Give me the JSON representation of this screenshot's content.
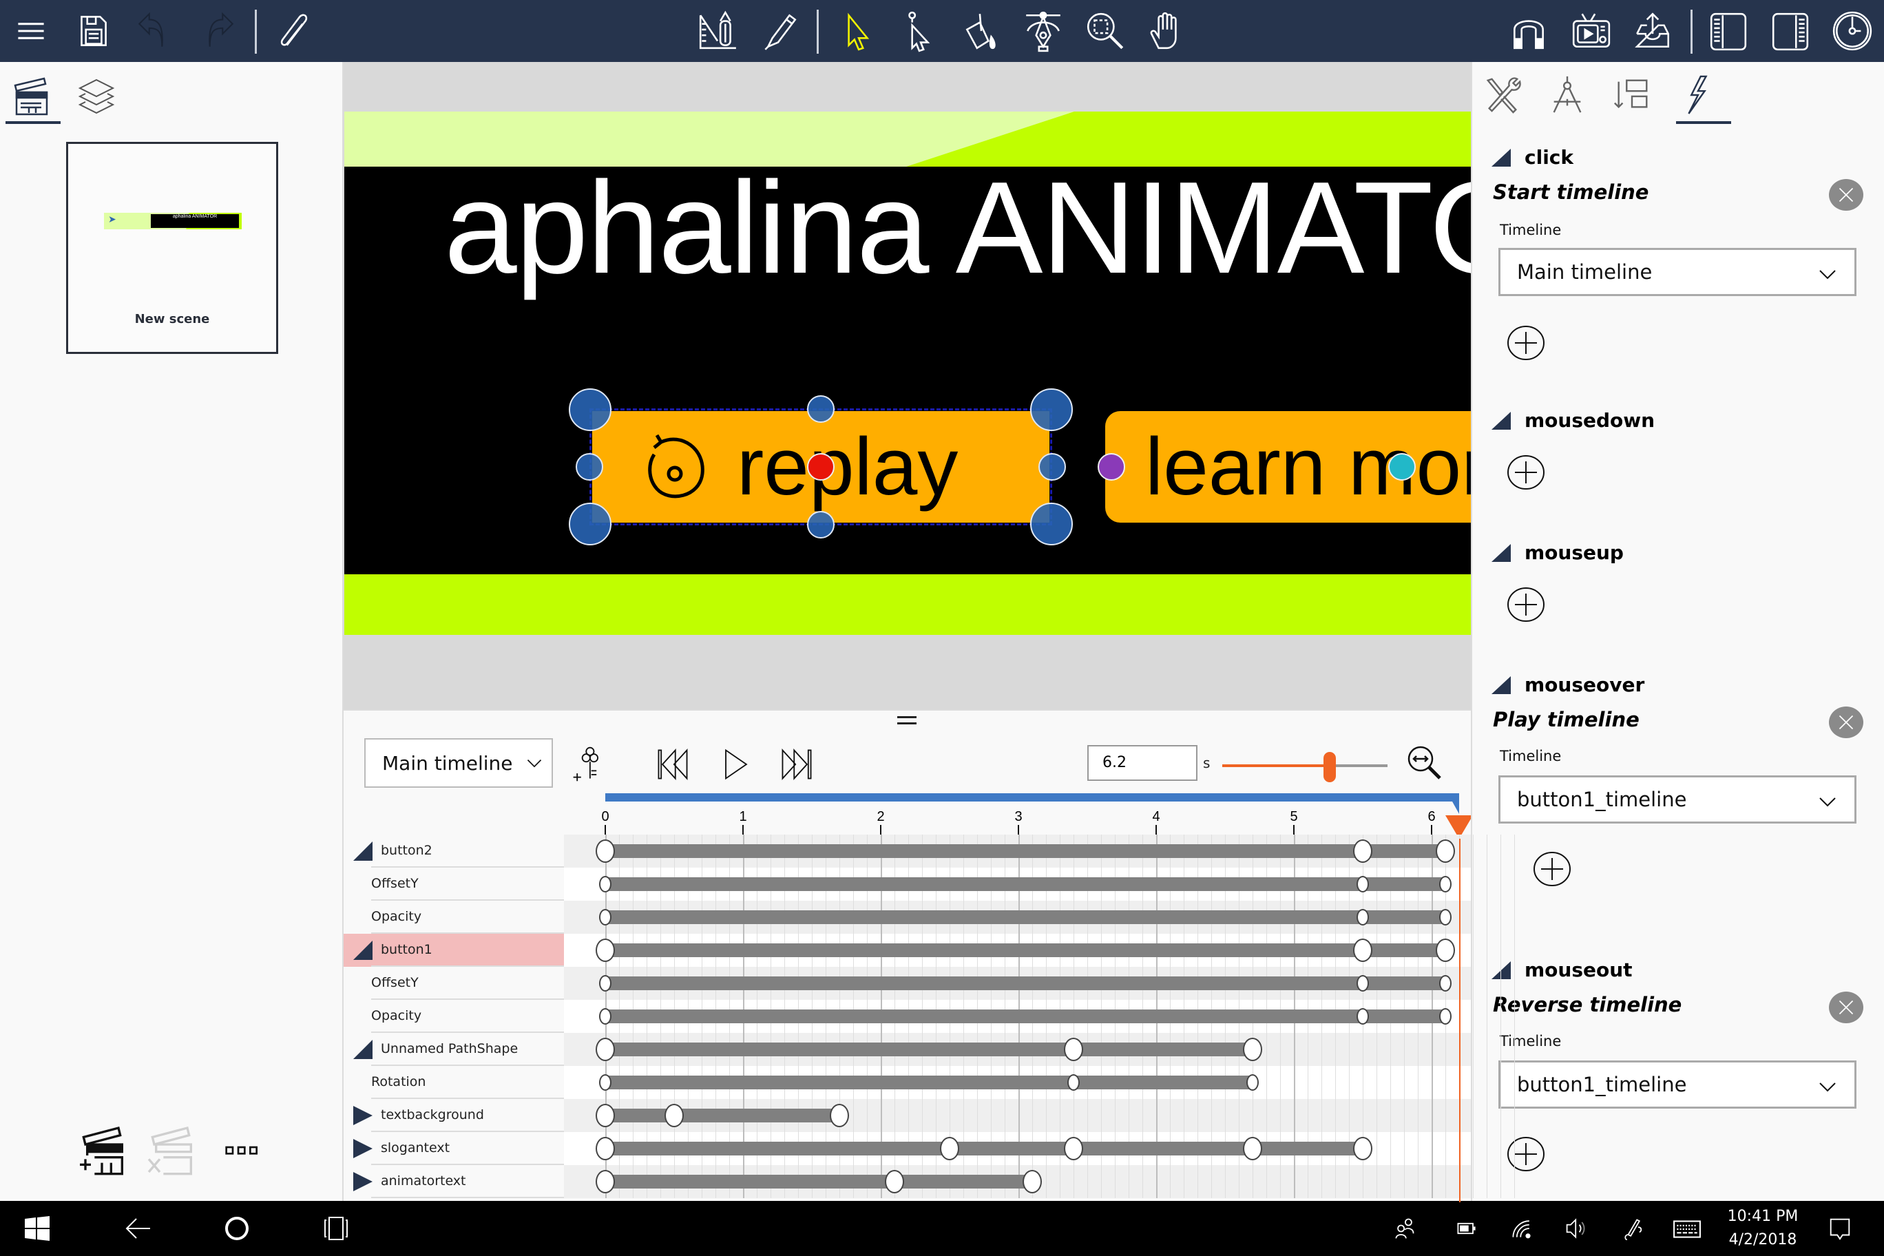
{
  "toolbar": {
    "left": [
      {
        "name": "menu-icon",
        "label": "Menu"
      },
      {
        "name": "save-icon",
        "label": "Save"
      },
      {
        "name": "undo-icon",
        "label": "Undo",
        "disabled": true
      },
      {
        "name": "redo-icon",
        "label": "Redo",
        "disabled": true
      },
      {
        "name": "paperclip-icon",
        "label": "Attach"
      }
    ],
    "center": [
      {
        "name": "ruler-pencil-icon",
        "label": "Draw shapes"
      },
      {
        "name": "pen-icon",
        "label": "Pen"
      },
      {
        "name": "select-arrow-icon",
        "label": "Select",
        "active": true
      },
      {
        "name": "node-select-icon",
        "label": "Direct select"
      },
      {
        "name": "paint-bucket-icon",
        "label": "Fill"
      },
      {
        "name": "bezier-pen-icon",
        "label": "Bezier"
      },
      {
        "name": "zoom-region-icon",
        "label": "Zoom"
      },
      {
        "name": "hand-icon",
        "label": "Pan"
      }
    ],
    "right": [
      {
        "name": "magnet-icon",
        "label": "Snap"
      },
      {
        "name": "preview-tv-icon",
        "label": "Preview"
      },
      {
        "name": "export-icon",
        "label": "Export"
      },
      {
        "name": "left-panel-icon",
        "label": "Toggle left panel"
      },
      {
        "name": "right-panel-icon",
        "label": "Toggle right panel"
      },
      {
        "name": "timeline-clock-icon",
        "label": "Timeline"
      }
    ],
    "accent_active": "#f2f200"
  },
  "left_panel": {
    "tabs": [
      {
        "name": "scenes-tab",
        "active": true
      },
      {
        "name": "layers-tab",
        "active": false
      }
    ],
    "scenes": [
      {
        "name": "New scene",
        "thumb_text": "aphalina ANIMATOR"
      }
    ],
    "bottom_actions": [
      "add-scene",
      "delete-scene",
      "more"
    ]
  },
  "canvas": {
    "title_text": "aphalina ANIMATOR",
    "buttons": [
      {
        "id": "button1",
        "label": "replay",
        "selected": true
      },
      {
        "id": "button2",
        "label": "learn more"
      }
    ],
    "colors": {
      "band": "#c0fe00",
      "band_light": "#e0fea4",
      "background": "#000000",
      "button": "#ffae00",
      "selection": "#2f68b0"
    }
  },
  "timeline": {
    "selected_timeline": "Main timeline",
    "current_time": "6.2",
    "time_unit": "s",
    "zoom_level": 0.65,
    "duration": 6.2,
    "ruler_ticks": [
      "0",
      "1",
      "2",
      "3",
      "4",
      "5",
      "6"
    ],
    "rows": [
      {
        "label": "button2",
        "type": "group",
        "expanded": true,
        "keyframes": [
          0,
          5.5,
          6.1
        ]
      },
      {
        "label": "OffsetY",
        "type": "property",
        "keyframes": [
          0,
          5.5,
          6.1
        ]
      },
      {
        "label": "Opacity",
        "type": "property",
        "keyframes": [
          0,
          5.5,
          6.1
        ]
      },
      {
        "label": "button1",
        "type": "group",
        "expanded": true,
        "selected": true,
        "keyframes": [
          0,
          5.5,
          6.1
        ]
      },
      {
        "label": "OffsetY",
        "type": "property",
        "keyframes": [
          0,
          5.5,
          6.1
        ]
      },
      {
        "label": "Opacity",
        "type": "property",
        "keyframes": [
          0,
          5.5,
          6.1
        ]
      },
      {
        "label": "Unnamed PathShape",
        "type": "group",
        "expanded": true,
        "keyframes": [
          0,
          3.4,
          4.7
        ]
      },
      {
        "label": "Rotation",
        "type": "property",
        "keyframes": [
          0,
          3.4,
          4.7
        ]
      },
      {
        "label": "textbackground",
        "type": "group",
        "expanded": false,
        "keyframes": [
          0,
          0.5,
          1.7
        ]
      },
      {
        "label": "slogantext",
        "type": "group",
        "expanded": false,
        "keyframes": [
          0,
          2.5,
          3.4,
          4.7,
          5.5
        ]
      },
      {
        "label": "animatortext",
        "type": "group",
        "expanded": false,
        "keyframes": [
          0,
          2.1,
          3.1
        ]
      }
    ],
    "colors": {
      "playhead": "#f06423",
      "range": "#3f7ac6",
      "bar": "#808080"
    }
  },
  "right_panel": {
    "tabs": [
      {
        "name": "tools-tab",
        "active": false
      },
      {
        "name": "geometry-tab",
        "active": false
      },
      {
        "name": "arrange-tab",
        "active": false
      },
      {
        "name": "events-tab",
        "active": true
      }
    ],
    "events": [
      {
        "name": "click",
        "action": "Start timeline",
        "field_label": "Timeline",
        "value": "Main timeline"
      },
      {
        "name": "mousedown"
      },
      {
        "name": "mouseup"
      },
      {
        "name": "mouseover",
        "action": "Play timeline",
        "field_label": "Timeline",
        "value": "button1_timeline"
      },
      {
        "name": "mouseout",
        "action": "Reverse timeline",
        "field_label": "Timeline",
        "value": "button1_timeline"
      }
    ]
  },
  "taskbar": {
    "time": "10:41 PM",
    "date": "4/2/2018",
    "icons": [
      "windows-start-icon",
      "back-arrow-icon",
      "cortana-icon",
      "task-view-icon",
      "people-icon",
      "battery-icon",
      "wifi-icon",
      "volume-icon",
      "pen-workspace-icon",
      "keyboard-icon",
      "action-center-icon"
    ]
  }
}
